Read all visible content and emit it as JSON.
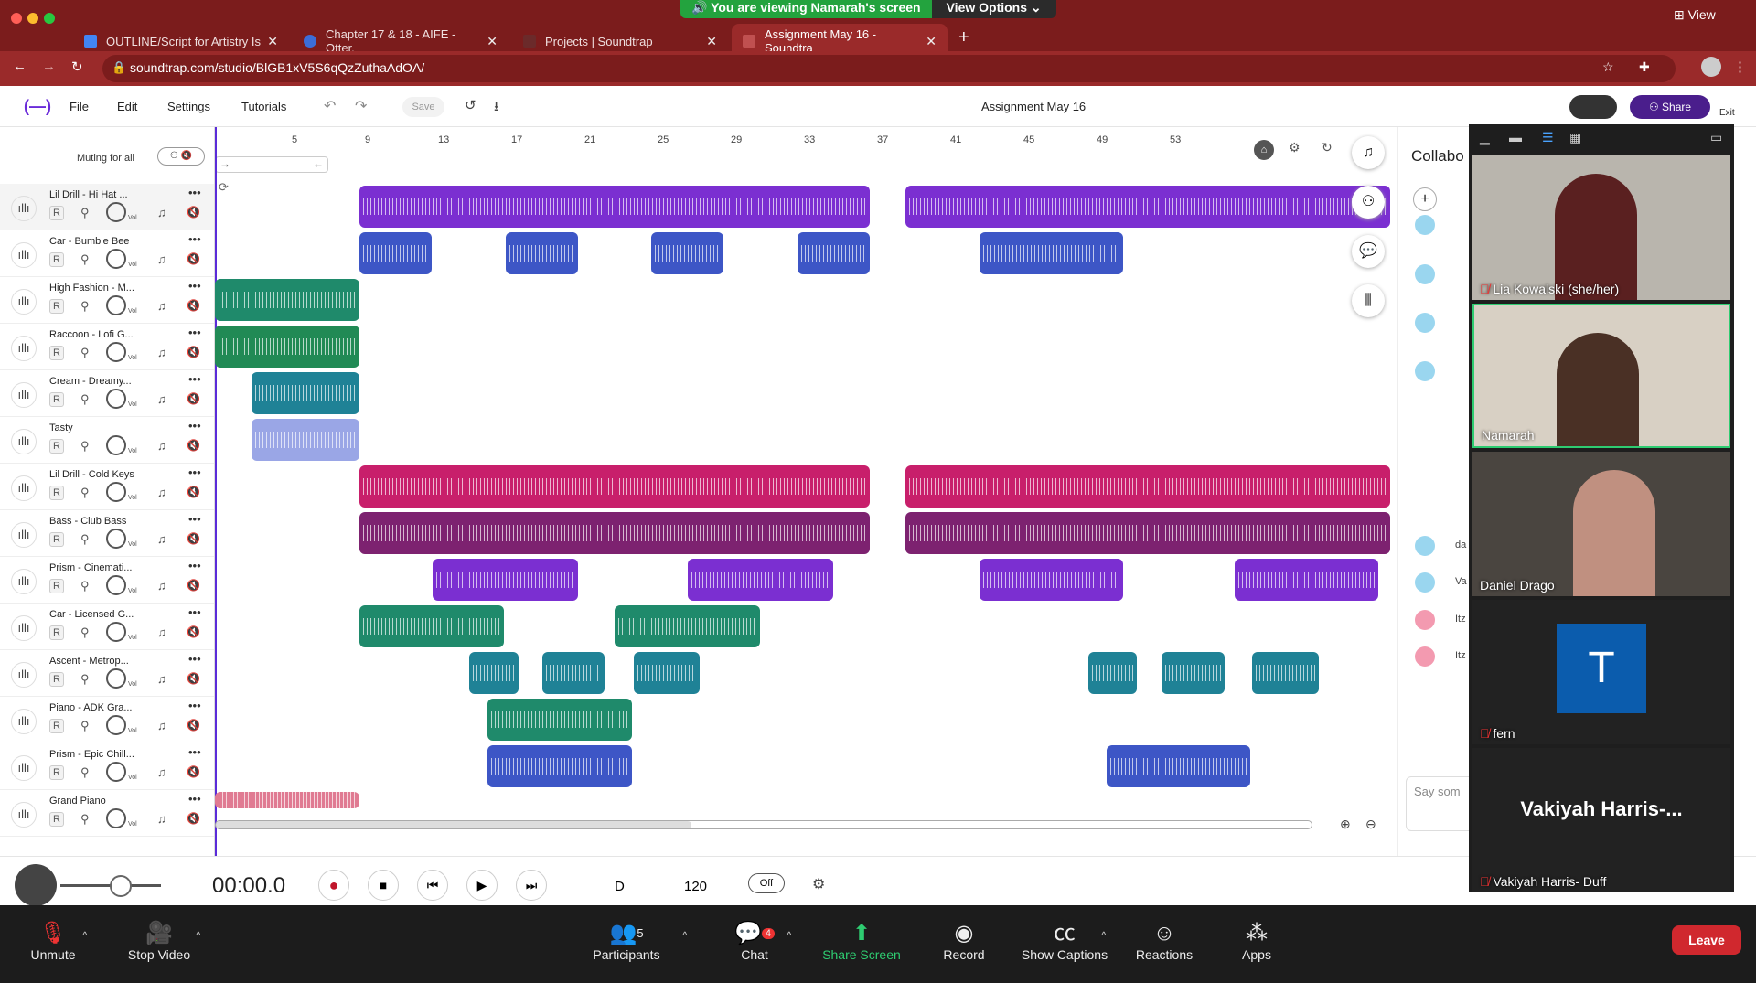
{
  "browser": {
    "banner_text": "You are viewing Namarah's screen",
    "view_options": "View Options",
    "view_label": "View",
    "tabs": [
      {
        "label": "OUTLINE/Script for Artistry Is",
        "active": false
      },
      {
        "label": "Chapter 17 & 18 - AIFE - Otter.",
        "active": false
      },
      {
        "label": "Projects | Soundtrap",
        "active": false
      },
      {
        "label": "Assignment May 16 - Soundtra",
        "active": true
      }
    ],
    "url": "soundtrap.com/studio/BlGB1xV5S6qQzZuthaAdOA/"
  },
  "soundtrap": {
    "menu": [
      "File",
      "Edit",
      "Settings",
      "Tutorials"
    ],
    "save_label": "Save",
    "project_title": "Assignment May 16",
    "share_label": "Share",
    "exit_label": "Exit",
    "muting_label": "Muting for all",
    "collab_label": "Collabo",
    "say_placeholder": "Say som",
    "collab_names": [
      "da",
      "Va",
      "Itz",
      "Itz"
    ],
    "ruler": [
      "5",
      "9",
      "13",
      "17",
      "21",
      "25",
      "29",
      "33",
      "37",
      "41",
      "45",
      "49",
      "53"
    ],
    "tracks": [
      {
        "name": "Lil Drill - Hi Hat ...",
        "r": "R"
      },
      {
        "name": "Car - Bumble Bee",
        "r": "R"
      },
      {
        "name": "High Fashion - M...",
        "r": "R"
      },
      {
        "name": "Raccoon - Lofi G...",
        "r": "R"
      },
      {
        "name": "Cream - Dreamy...",
        "r": "R"
      },
      {
        "name": "Tasty",
        "r": "R"
      },
      {
        "name": "Lil Drill - Cold Keys",
        "r": "R"
      },
      {
        "name": "Bass - Club Bass",
        "r": "R"
      },
      {
        "name": "Prism - Cinemati...",
        "r": "R"
      },
      {
        "name": "Car - Licensed G...",
        "r": "R"
      },
      {
        "name": "Ascent - Metrop...",
        "r": "R"
      },
      {
        "name": "Piano - ADK Gra...",
        "r": "R"
      },
      {
        "name": "Prism - Epic Chill...",
        "r": "R"
      },
      {
        "name": "Grand Piano",
        "r": "R"
      }
    ],
    "vol_label": "Vol",
    "transport": {
      "time": "00:00.0",
      "key": "D",
      "tempo": "120",
      "off_label": "Off"
    }
  },
  "zoom": {
    "participants": [
      {
        "name": "Lia Kowalski (she/her)"
      },
      {
        "name": "Namarah"
      },
      {
        "name": "Daniel Drago"
      },
      {
        "name": "fern",
        "avatar_letter": "T"
      },
      {
        "name": "Vakiyah Harris- Duff",
        "big_label": "Vakiyah  Harris-..."
      }
    ],
    "toolbar": {
      "unmute": "Unmute",
      "stop_video": "Stop Video",
      "participants": "Participants",
      "participants_count": "5",
      "chat": "Chat",
      "chat_badge": "4",
      "share_screen": "Share Screen",
      "record": "Record",
      "show_captions": "Show Captions",
      "reactions": "Reactions",
      "apps": "Apps",
      "leave": "Leave"
    }
  }
}
